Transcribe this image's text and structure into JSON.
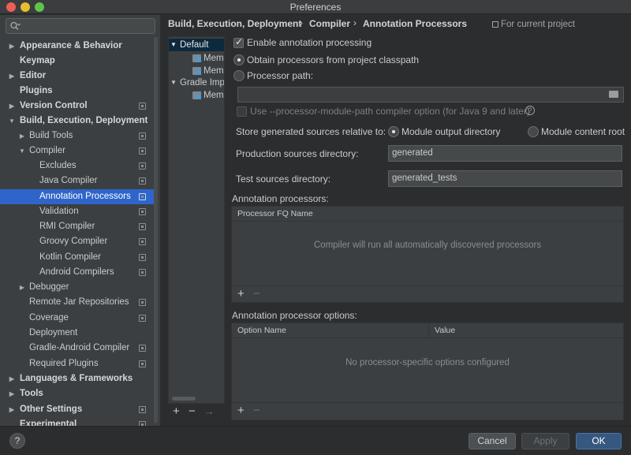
{
  "window": {
    "title": "Preferences"
  },
  "search": {
    "placeholder": ""
  },
  "sidebar": {
    "items": [
      {
        "label": "Appearance & Behavior"
      },
      {
        "label": "Keymap"
      },
      {
        "label": "Editor"
      },
      {
        "label": "Plugins"
      },
      {
        "label": "Version Control"
      },
      {
        "label": "Build, Execution, Deployment"
      },
      {
        "label": "Build Tools"
      },
      {
        "label": "Compiler"
      },
      {
        "label": "Excludes"
      },
      {
        "label": "Java Compiler"
      },
      {
        "label": "Annotation Processors"
      },
      {
        "label": "Validation"
      },
      {
        "label": "RMI Compiler"
      },
      {
        "label": "Groovy Compiler"
      },
      {
        "label": "Kotlin Compiler"
      },
      {
        "label": "Android Compilers"
      },
      {
        "label": "Debugger"
      },
      {
        "label": "Remote Jar Repositories"
      },
      {
        "label": "Coverage"
      },
      {
        "label": "Deployment"
      },
      {
        "label": "Gradle-Android Compiler"
      },
      {
        "label": "Required Plugins"
      },
      {
        "label": "Languages & Frameworks"
      },
      {
        "label": "Tools"
      },
      {
        "label": "Other Settings"
      },
      {
        "label": "Experimental"
      }
    ]
  },
  "breadcrumb": {
    "part1": "Build, Execution, Deployment",
    "part2": "Compiler",
    "part3": "Annotation Processors",
    "separator": "›",
    "for_project": "For current project"
  },
  "profiles": {
    "items": [
      {
        "label": "Default"
      },
      {
        "label": "Mem"
      },
      {
        "label": "Mem"
      },
      {
        "label": "Gradle Imp"
      },
      {
        "label": "Mem"
      }
    ],
    "add": "+",
    "remove": "−",
    "move": "→"
  },
  "form": {
    "enable_processing": "Enable annotation processing",
    "obtain_classpath": "Obtain processors from project classpath",
    "processor_path": "Processor path:",
    "processor_path_value": "",
    "module_path_option": "Use --processor-module-path compiler option (for Java 9 and later)",
    "store_relative": "Store generated sources relative to:",
    "module_output": "Module output directory",
    "module_content": "Module content root",
    "prod_dir_label": "Production sources directory:",
    "prod_dir_value": "generated",
    "test_dir_label": "Test sources directory:",
    "test_dir_value": "generated_tests"
  },
  "processors_table": {
    "title": "Annotation processors:",
    "header": "Processor FQ Name",
    "empty": "Compiler will run all automatically discovered processors",
    "add": "+",
    "remove": "−"
  },
  "options_table": {
    "title": "Annotation processor options:",
    "header_name": "Option Name",
    "header_value": "Value",
    "empty": "No processor-specific options configured",
    "add": "+",
    "remove": "−"
  },
  "buttons": {
    "help": "?",
    "cancel": "Cancel",
    "apply": "Apply",
    "ok": "OK"
  }
}
